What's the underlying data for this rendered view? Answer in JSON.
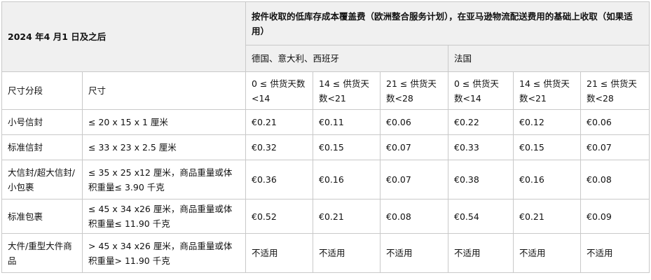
{
  "table": {
    "corner_label": "2024 年4 月1 日及之后",
    "main_header": "按件收取的低库存成本覆盖费（欧洲整合服务计划），在亚马逊物流配送费用的基础上收取（如果适用）",
    "region_groups": [
      "德国、意大利、西班牙",
      "法国"
    ],
    "col_size_tier": "尺寸分段",
    "col_dimensions": "尺寸",
    "supply_days": [
      "0 ≤ 供货天数<14",
      "14 ≤ 供货天数<21",
      "21 ≤ 供货天数<28",
      "0 ≤ 供货天数<14",
      "14 ≤ 供货天数<21",
      "21 ≤ 供货天数<28"
    ],
    "rows": [
      {
        "tier": "小号信封",
        "size": "≤ 20 x 15 x 1 厘米",
        "fees": [
          "€0.21",
          "€0.11",
          "€0.06",
          "€0.22",
          "€0.12",
          "€0.06"
        ]
      },
      {
        "tier": "标准信封",
        "size": "≤ 33 x 23 x 2.5 厘米",
        "fees": [
          "€0.32",
          "€0.15",
          "€0.07",
          "€0.33",
          "€0.15",
          "€0.07"
        ]
      },
      {
        "tier": "大信封/超大信封/小包裹",
        "size": "≤ 35 x 25 x12 厘米，商品重量或体积重量≤ 3.90 千克",
        "fees": [
          "€0.36",
          "€0.16",
          "€0.07",
          "€0.38",
          "€0.16",
          "€0.08"
        ]
      },
      {
        "tier": "标准包裹",
        "size": "≤ 45 x 34 x26 厘米，商品重量或体积重量≤ 11.90 千克",
        "fees": [
          "€0.52",
          "€0.21",
          "€0.08",
          "€0.54",
          "€0.21",
          "€0.09"
        ]
      },
      {
        "tier": "大件/重型大件商品",
        "size": "> 45 x 34 x26 厘米，商品重量或体积重量> 11.90 千克",
        "fees": [
          "不适用",
          "不适用",
          "不适用",
          "不适用",
          "不适用",
          "不适用"
        ]
      }
    ]
  }
}
